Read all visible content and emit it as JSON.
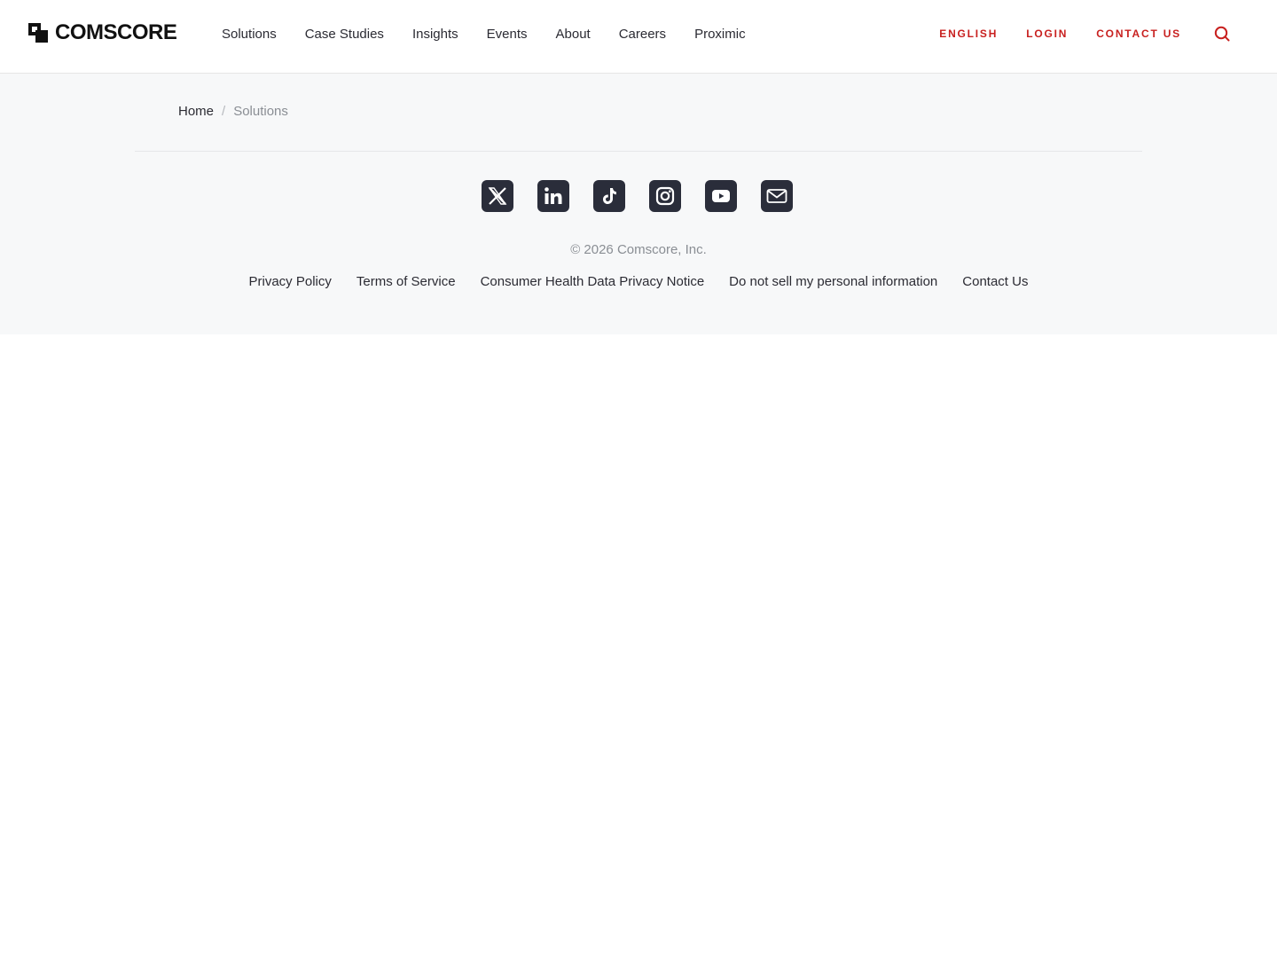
{
  "header": {
    "logo_text": "COMSCORE",
    "nav": [
      {
        "label": "Solutions"
      },
      {
        "label": "Case Studies"
      },
      {
        "label": "Insights"
      },
      {
        "label": "Events"
      },
      {
        "label": "About"
      },
      {
        "label": "Careers"
      },
      {
        "label": "Proximic"
      }
    ],
    "utility": {
      "language": "ENGLISH",
      "login": "LOGIN",
      "contact": "CONTACT US"
    },
    "search_icon": "search-icon"
  },
  "breadcrumb": {
    "home": "Home",
    "separator": "/",
    "current": "Solutions"
  },
  "social_icons": [
    "x-icon",
    "linkedin-icon",
    "tiktok-icon",
    "instagram-icon",
    "youtube-icon",
    "email-icon"
  ],
  "footer": {
    "copyright": "© 2026 Comscore, Inc.",
    "links": [
      {
        "label": "Privacy Policy"
      },
      {
        "label": "Terms of Service"
      },
      {
        "label": "Consumer Health Data Privacy Notice"
      },
      {
        "label": "Do not sell my personal information"
      },
      {
        "label": "Contact Us"
      }
    ]
  },
  "colors": {
    "accent": "#c8201f",
    "text": "#2b2b33",
    "muted": "#8a8e94",
    "band": "#f7f8f9",
    "icon_bg": "#2a2d3a"
  }
}
